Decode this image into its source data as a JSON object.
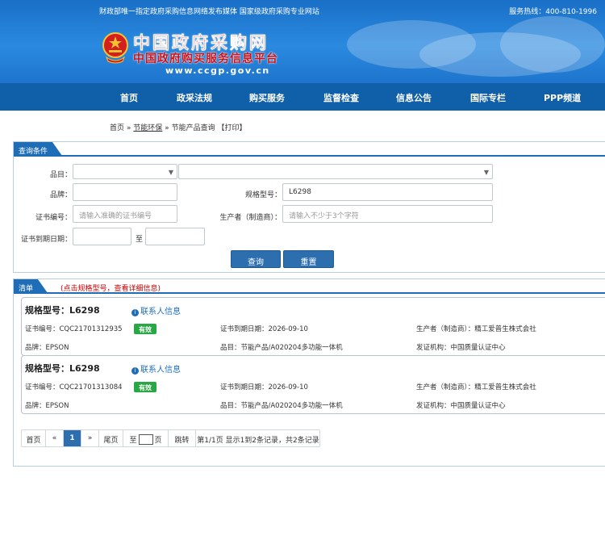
{
  "header": {
    "slogan": "财政部唯一指定政府采购信息网络发布媒体 国家级政府采购专业网站",
    "hotline": "服务热线：400-810-1996",
    "logo_line1": "中国政府采购网",
    "logo_line2": "中国政府购买服务信息平台",
    "logo_url": "www.ccgp.gov.cn"
  },
  "nav": [
    "首页",
    "政采法规",
    "购买服务",
    "监督检查",
    "信息公告",
    "国际专栏",
    "PPP频道"
  ],
  "breadcrumb": {
    "home": "首页",
    "sep": "»",
    "category": "节能环保",
    "current": "节能产品查询",
    "print": "【打印】"
  },
  "query": {
    "title": "查询条件",
    "item_label": "品目：",
    "brand_label": "品牌：",
    "brand_value": "",
    "model_label": "规格型号：",
    "model_value": "L6298",
    "cert_label": "证书编号：",
    "cert_placeholder": "请输入准确的证书编号",
    "maker_label": "生产者（制造商）：",
    "maker_placeholder": "请输入不少于3个字符",
    "expire_label": "证书到期日期：",
    "to": "至",
    "search_btn": "查询",
    "reset_btn": "重置"
  },
  "list": {
    "title": "清单",
    "hint": "(点击规格型号，查看详细信息)",
    "items": [
      {
        "model": "规格型号：L6298",
        "contact": "联系人信息",
        "cert": "证书编号：CQC21701312935",
        "status": "有效",
        "expire": "证书到期日期：2026-09-10",
        "maker": "生产者（制造商）：精工爱普生株式会社",
        "brand": "品牌：EPSON",
        "category": "品目：节能产品/A020204多功能一体机",
        "issuer": "发证机构：中国质量认证中心"
      },
      {
        "model": "规格型号：L6298",
        "contact": "联系人信息",
        "cert": "证书编号：CQC21701313084",
        "status": "有效",
        "expire": "证书到期日期：2026-09-10",
        "maker": "生产者（制造商）：精工爱普生株式会社",
        "brand": "品牌：EPSON",
        "category": "品目：节能产品/A020204多功能一体机",
        "issuer": "发证机构：中国质量认证中心"
      }
    ]
  },
  "pager": {
    "first": "首页",
    "prev": "«",
    "current": "1",
    "next": "»",
    "last": "尾页",
    "goto_pre": "至",
    "goto_post": "页",
    "jump": "跳转",
    "summary": "第1/1页  显示1到2条记录，共2条记录"
  },
  "colors": {
    "accent": "#1f6db7",
    "nav": "#0f5fa9",
    "valid": "#28a745",
    "hint": "#cc0000"
  }
}
